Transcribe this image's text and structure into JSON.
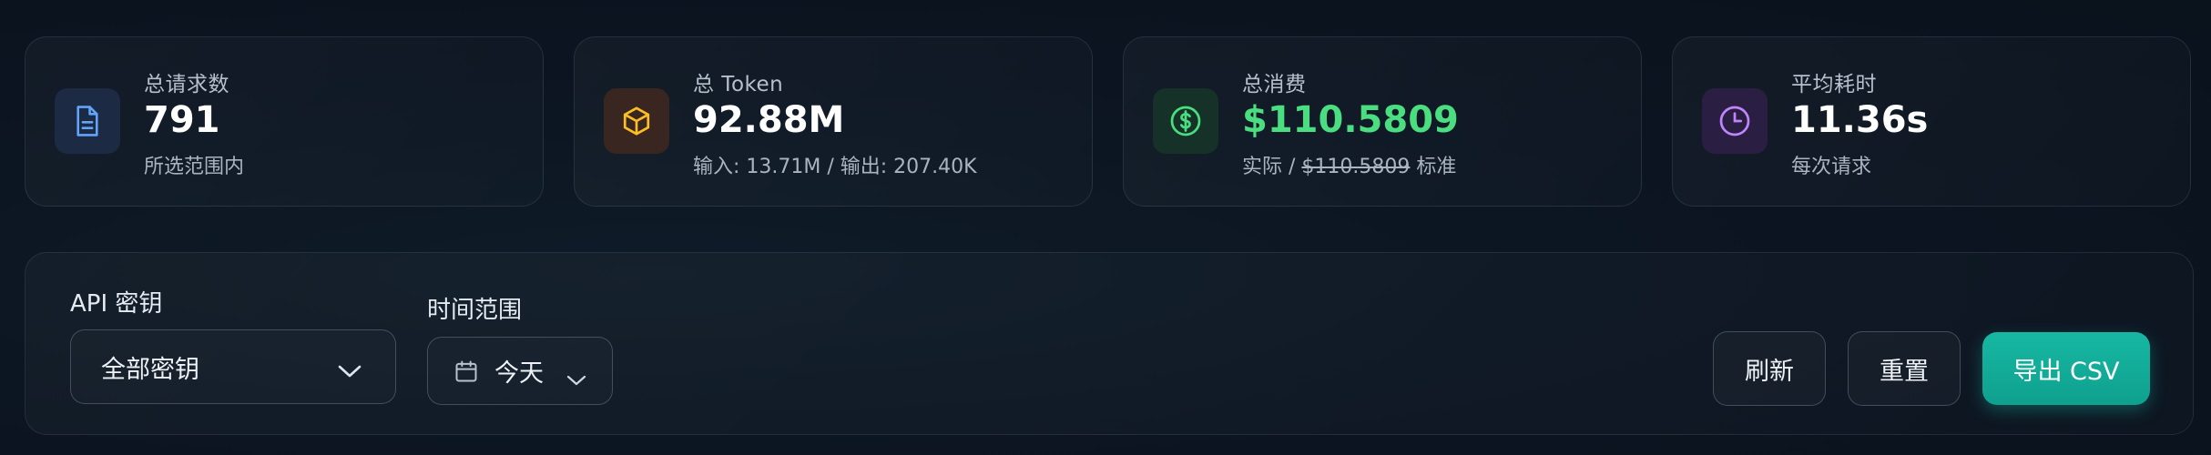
{
  "stats": [
    {
      "label": "总请求数",
      "value": "791",
      "sub": "所选范围内",
      "icon": "document-icon",
      "accent": "#60a5fa"
    },
    {
      "label": "总 Token",
      "value": "92.88M",
      "sub": "输入: 13.71M / 输出: 207.40K",
      "icon": "cube-icon",
      "accent": "#fbbf24"
    },
    {
      "label": "总消费",
      "value": "$110.5809",
      "sub_prefix": "实际 / ",
      "sub_strike": "$110.5809",
      "sub_suffix": " 标准",
      "icon": "dollar-icon",
      "accent": "#4ade80"
    },
    {
      "label": "平均耗时",
      "value": "11.36s",
      "sub": "每次请求",
      "icon": "clock-icon",
      "accent": "#c084fc"
    }
  ],
  "filters": {
    "api_key_label": "API 密钥",
    "api_key_value": "全部密钥",
    "time_label": "时间范围",
    "time_value": "今天"
  },
  "actions": {
    "refresh": "刷新",
    "reset": "重置",
    "export": "导出 CSV"
  },
  "colors": {
    "primary": "#14b8a6",
    "value_green": "#4ade80"
  }
}
